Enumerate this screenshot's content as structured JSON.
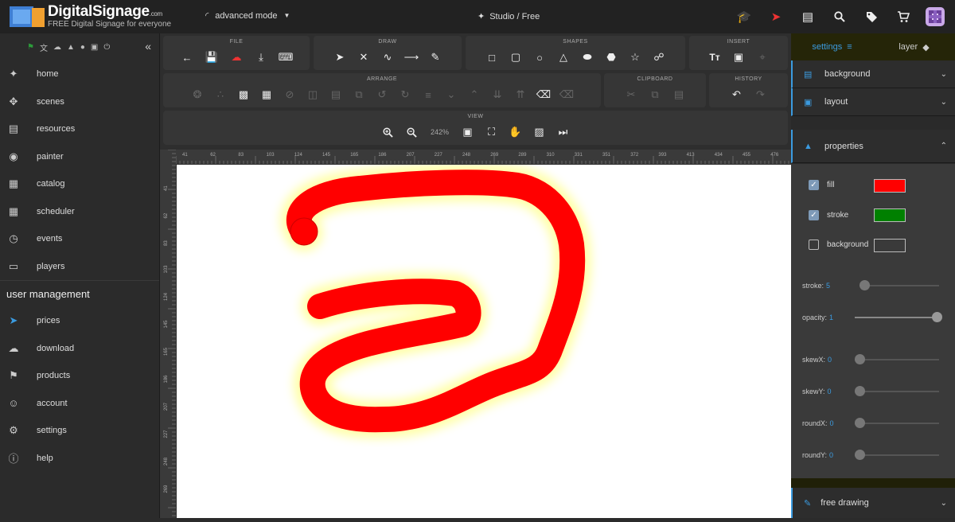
{
  "header": {
    "logo_title": "DigitalSignage",
    "logo_com": ".com",
    "logo_subtitle": "FREE Digital Signage for everyone",
    "mode_label": "advanced mode",
    "studio_label": "Studio / Free",
    "icons": [
      "graduation-cap-icon",
      "rocket-icon",
      "chat-icon",
      "search-icon",
      "tag-icon",
      "cart-icon",
      "avatar"
    ]
  },
  "sidebar": {
    "top_icons": [
      "flag-icon",
      "translate-icon",
      "cloud-icon",
      "tray-icon",
      "bulb-icon",
      "screen-icon",
      "power-icon"
    ],
    "items": [
      {
        "label": "home",
        "icon": "compass-icon"
      },
      {
        "label": "scenes",
        "icon": "move-icon"
      },
      {
        "label": "resources",
        "icon": "images-icon"
      },
      {
        "label": "painter",
        "icon": "palette-icon"
      },
      {
        "label": "catalog",
        "icon": "catalog-icon"
      },
      {
        "label": "scheduler",
        "icon": "calendar-icon"
      },
      {
        "label": "events",
        "icon": "alarm-icon"
      },
      {
        "label": "players",
        "icon": "monitor-icon"
      }
    ],
    "section_title": "user management",
    "user_items": [
      {
        "label": "prices",
        "icon": "rocket-icon"
      },
      {
        "label": "download",
        "icon": "cloud-download-icon"
      },
      {
        "label": "products",
        "icon": "tag-icon"
      },
      {
        "label": "account",
        "icon": "face-icon"
      },
      {
        "label": "settings",
        "icon": "gear-icon"
      },
      {
        "label": "help",
        "icon": "help-icon"
      }
    ]
  },
  "toolbar": {
    "file_title": "FILE",
    "draw_title": "DRAW",
    "shapes_title": "SHAPES",
    "insert_title": "INSERT",
    "arrange_title": "ARRANGE",
    "clipboard_title": "CLIPBOARD",
    "history_title": "HISTORY",
    "view_title": "VIEW",
    "zoom_level": "242%"
  },
  "ruler": {
    "h_ticks": [
      "41",
      "62",
      "83",
      "103",
      "124",
      "145",
      "165",
      "186",
      "207",
      "227",
      "248",
      "269",
      "289",
      "310",
      "331",
      "351",
      "372",
      "393",
      "413",
      "434",
      "455",
      "476"
    ],
    "v_ticks": [
      "41",
      "62",
      "83",
      "103",
      "124",
      "145",
      "165",
      "186",
      "207",
      "227",
      "248",
      "269"
    ]
  },
  "panel": {
    "tab_settings": "settings",
    "tab_layer": "layer",
    "background_label": "background",
    "layout_label": "layout",
    "properties_label": "properties",
    "fill_label": "fill",
    "stroke_label": "stroke",
    "bg_label": "background",
    "fill_color": "#ff0000",
    "stroke_color": "#008000",
    "stroke_text": "stroke:",
    "stroke_value": "5",
    "opacity_text": "opacity:",
    "opacity_value": "1",
    "skewx_text": "skewX:",
    "skewx_value": "0",
    "skewy_text": "skewY:",
    "skewy_value": "0",
    "roundx_text": "roundX:",
    "roundx_value": "0",
    "roundy_text": "roundY:",
    "roundy_value": "0",
    "free_drawing_label": "free drawing"
  }
}
